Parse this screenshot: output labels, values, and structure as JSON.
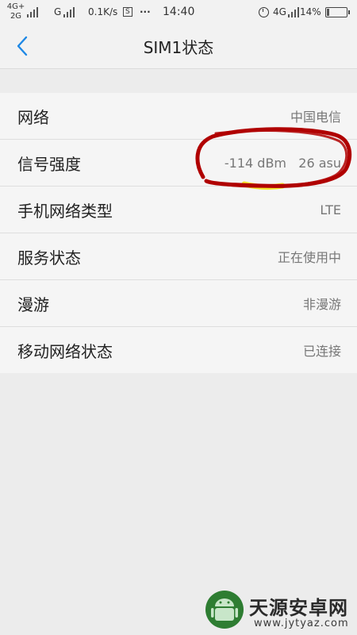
{
  "status_bar": {
    "net_type_1": "4G+",
    "net_type_2": "2G",
    "sim2_label": "G",
    "speed": "0.1K/s",
    "sim_badge": "S",
    "more": "···",
    "time": "14:40",
    "lte_label": "4G",
    "battery": "14%",
    "battery_level": 0.14
  },
  "header": {
    "title": "SIM1状态"
  },
  "items": [
    {
      "label": "网络",
      "value": "中国电信"
    },
    {
      "label": "信号强度",
      "value": "-114 dBm   26 asu"
    },
    {
      "label": "手机网络类型",
      "value": "LTE"
    },
    {
      "label": "服务状态",
      "value": "正在使用中"
    },
    {
      "label": "漫游",
      "value": "非漫游"
    },
    {
      "label": "移动网络状态",
      "value": "已连接"
    }
  ],
  "watermark": {
    "title": "天源安卓网",
    "url": "www.jytyaz.com"
  },
  "colors": {
    "accent": "#1e88e5",
    "annotation": "#b00000",
    "highlight": "#f5e21a"
  }
}
